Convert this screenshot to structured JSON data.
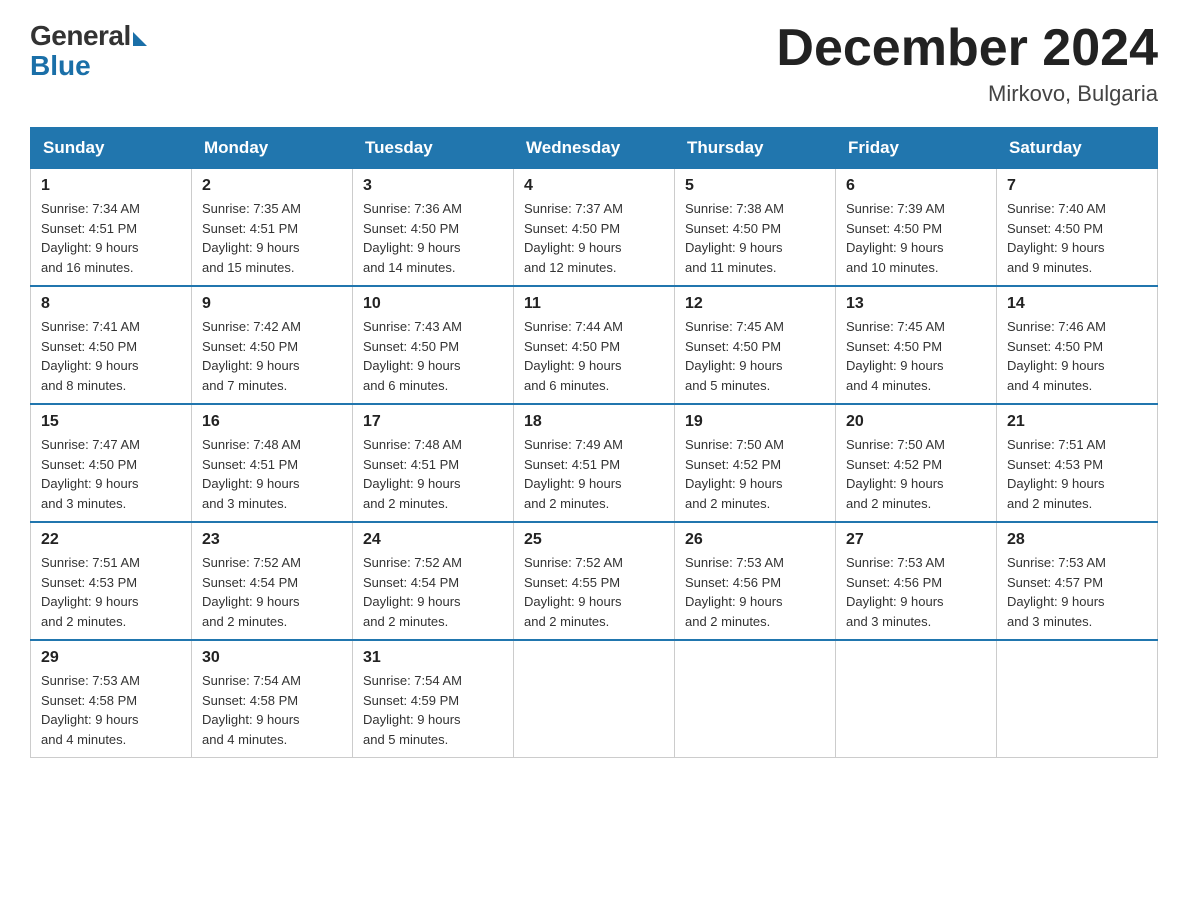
{
  "header": {
    "logo": {
      "general": "General",
      "blue": "Blue"
    },
    "title": "December 2024",
    "location": "Mirkovo, Bulgaria"
  },
  "weekdays": [
    "Sunday",
    "Monday",
    "Tuesday",
    "Wednesday",
    "Thursday",
    "Friday",
    "Saturday"
  ],
  "weeks": [
    [
      {
        "day": 1,
        "sunrise": "7:34 AM",
        "sunset": "4:51 PM",
        "daylight": "9 hours and 16 minutes."
      },
      {
        "day": 2,
        "sunrise": "7:35 AM",
        "sunset": "4:51 PM",
        "daylight": "9 hours and 15 minutes."
      },
      {
        "day": 3,
        "sunrise": "7:36 AM",
        "sunset": "4:50 PM",
        "daylight": "9 hours and 14 minutes."
      },
      {
        "day": 4,
        "sunrise": "7:37 AM",
        "sunset": "4:50 PM",
        "daylight": "9 hours and 12 minutes."
      },
      {
        "day": 5,
        "sunrise": "7:38 AM",
        "sunset": "4:50 PM",
        "daylight": "9 hours and 11 minutes."
      },
      {
        "day": 6,
        "sunrise": "7:39 AM",
        "sunset": "4:50 PM",
        "daylight": "9 hours and 10 minutes."
      },
      {
        "day": 7,
        "sunrise": "7:40 AM",
        "sunset": "4:50 PM",
        "daylight": "9 hours and 9 minutes."
      }
    ],
    [
      {
        "day": 8,
        "sunrise": "7:41 AM",
        "sunset": "4:50 PM",
        "daylight": "9 hours and 8 minutes."
      },
      {
        "day": 9,
        "sunrise": "7:42 AM",
        "sunset": "4:50 PM",
        "daylight": "9 hours and 7 minutes."
      },
      {
        "day": 10,
        "sunrise": "7:43 AM",
        "sunset": "4:50 PM",
        "daylight": "9 hours and 6 minutes."
      },
      {
        "day": 11,
        "sunrise": "7:44 AM",
        "sunset": "4:50 PM",
        "daylight": "9 hours and 6 minutes."
      },
      {
        "day": 12,
        "sunrise": "7:45 AM",
        "sunset": "4:50 PM",
        "daylight": "9 hours and 5 minutes."
      },
      {
        "day": 13,
        "sunrise": "7:45 AM",
        "sunset": "4:50 PM",
        "daylight": "9 hours and 4 minutes."
      },
      {
        "day": 14,
        "sunrise": "7:46 AM",
        "sunset": "4:50 PM",
        "daylight": "9 hours and 4 minutes."
      }
    ],
    [
      {
        "day": 15,
        "sunrise": "7:47 AM",
        "sunset": "4:50 PM",
        "daylight": "9 hours and 3 minutes."
      },
      {
        "day": 16,
        "sunrise": "7:48 AM",
        "sunset": "4:51 PM",
        "daylight": "9 hours and 3 minutes."
      },
      {
        "day": 17,
        "sunrise": "7:48 AM",
        "sunset": "4:51 PM",
        "daylight": "9 hours and 2 minutes."
      },
      {
        "day": 18,
        "sunrise": "7:49 AM",
        "sunset": "4:51 PM",
        "daylight": "9 hours and 2 minutes."
      },
      {
        "day": 19,
        "sunrise": "7:50 AM",
        "sunset": "4:52 PM",
        "daylight": "9 hours and 2 minutes."
      },
      {
        "day": 20,
        "sunrise": "7:50 AM",
        "sunset": "4:52 PM",
        "daylight": "9 hours and 2 minutes."
      },
      {
        "day": 21,
        "sunrise": "7:51 AM",
        "sunset": "4:53 PM",
        "daylight": "9 hours and 2 minutes."
      }
    ],
    [
      {
        "day": 22,
        "sunrise": "7:51 AM",
        "sunset": "4:53 PM",
        "daylight": "9 hours and 2 minutes."
      },
      {
        "day": 23,
        "sunrise": "7:52 AM",
        "sunset": "4:54 PM",
        "daylight": "9 hours and 2 minutes."
      },
      {
        "day": 24,
        "sunrise": "7:52 AM",
        "sunset": "4:54 PM",
        "daylight": "9 hours and 2 minutes."
      },
      {
        "day": 25,
        "sunrise": "7:52 AM",
        "sunset": "4:55 PM",
        "daylight": "9 hours and 2 minutes."
      },
      {
        "day": 26,
        "sunrise": "7:53 AM",
        "sunset": "4:56 PM",
        "daylight": "9 hours and 2 minutes."
      },
      {
        "day": 27,
        "sunrise": "7:53 AM",
        "sunset": "4:56 PM",
        "daylight": "9 hours and 3 minutes."
      },
      {
        "day": 28,
        "sunrise": "7:53 AM",
        "sunset": "4:57 PM",
        "daylight": "9 hours and 3 minutes."
      }
    ],
    [
      {
        "day": 29,
        "sunrise": "7:53 AM",
        "sunset": "4:58 PM",
        "daylight": "9 hours and 4 minutes."
      },
      {
        "day": 30,
        "sunrise": "7:54 AM",
        "sunset": "4:58 PM",
        "daylight": "9 hours and 4 minutes."
      },
      {
        "day": 31,
        "sunrise": "7:54 AM",
        "sunset": "4:59 PM",
        "daylight": "9 hours and 5 minutes."
      },
      null,
      null,
      null,
      null
    ]
  ],
  "labels": {
    "sunrise": "Sunrise:",
    "sunset": "Sunset:",
    "daylight": "Daylight:"
  }
}
